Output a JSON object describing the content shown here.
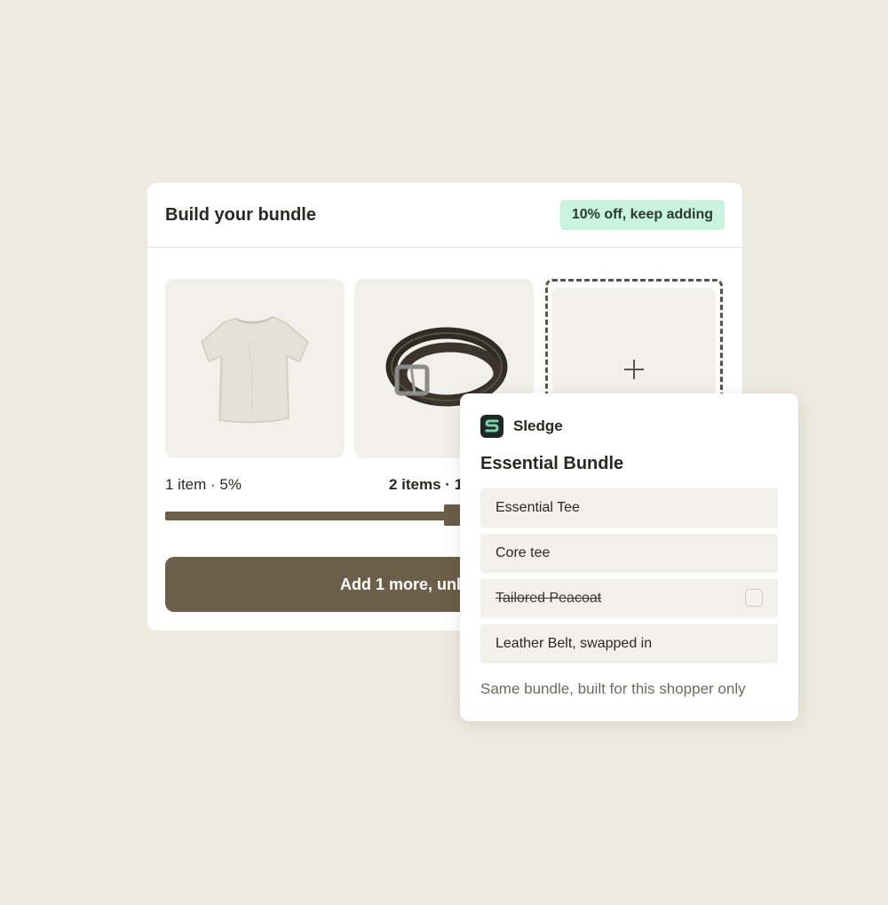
{
  "bundle_card": {
    "title": "Build your bundle",
    "badge": "10% off, keep adding",
    "slots": [
      {
        "name": "t-shirt",
        "icon": "tshirt-image"
      },
      {
        "name": "belt",
        "icon": "belt-image"
      },
      {
        "name": "empty",
        "icon": "plus-icon"
      }
    ],
    "tiers": {
      "first": "1 item · 5%",
      "second": "2 items · 1"
    },
    "progress_fraction": 0.64,
    "cta_label": "Add 1 more, unl"
  },
  "popup": {
    "brand": "Sledge",
    "bundle_title": "Essential Bundle",
    "items": [
      {
        "label": "Essential Tee",
        "struck": false
      },
      {
        "label": "Core tee",
        "struck": false
      },
      {
        "label": "Tailored Peacoat",
        "struck": true
      },
      {
        "label": "Leather Belt, swapped in",
        "struck": false
      }
    ],
    "footnote": "Same bundle, built for this shopper only"
  },
  "colors": {
    "background": "#edeadf",
    "accent_brown": "#6b5f4a",
    "badge_green": "#c9f3df",
    "tile": "#f2f0eb"
  }
}
